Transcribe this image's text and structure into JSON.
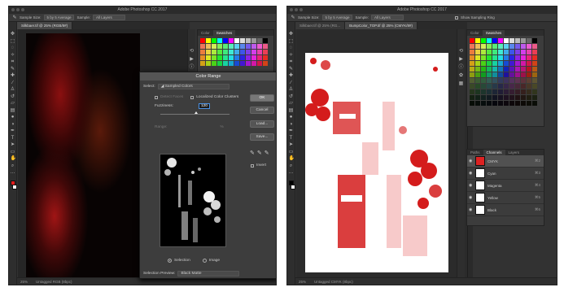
{
  "app_title": "Adobe Photoshop CC 2017",
  "left": {
    "options": {
      "sample_size_label": "Sample Size:",
      "sample_size_value": "5 by 5 Average",
      "sample_label": "Sample:",
      "sample_value": "All Layers"
    },
    "doc_tab": "Silkbaer.tif @ 25% (RGB/8#)",
    "status_zoom": "25%",
    "status_profile": "Untagged RGB (8bpc)",
    "panel_tabs": [
      "Color",
      "Swatches"
    ],
    "dialog": {
      "title": "Color Range",
      "select_label": "Select:",
      "select_value": "Sampled Colors",
      "detect_faces": "Detect Faces",
      "localized": "Localized Color Clusters",
      "fuzziness_label": "Fuzziness:",
      "fuzziness_value": "120",
      "range_label": "Range:",
      "range_unit": "%",
      "buttons": [
        "OK",
        "Cancel",
        "Load...",
        "Save..."
      ],
      "invert": "Invert",
      "selection_label": "Selection",
      "image_label": "Image",
      "preview_label": "Selection Preview:",
      "preview_value": "Black Matte"
    }
  },
  "right": {
    "options": {
      "sample_size_label": "Sample Size:",
      "sample_size_value": "5 by 5 Average",
      "sample_label": "Sample:",
      "sample_value": "All Layers",
      "extra": "Show Sampling Ring"
    },
    "doc_tabs": [
      "Silkbaer.tif @ 25% (RG...",
      "BumpColor_TOP.tif @ 25% (CMYK/8#)"
    ],
    "status_zoom": "25%",
    "status_profile": "Untagged CMYK (8bpc)",
    "panel_tabs": [
      "Color",
      "Swatches"
    ],
    "channel_tabs": [
      "Paths",
      "Channels",
      "Layers"
    ],
    "channels": [
      {
        "name": "CMYK",
        "key": "⌘2",
        "thumb": "#d22"
      },
      {
        "name": "Cyan",
        "key": "⌘3",
        "thumb": "#fff"
      },
      {
        "name": "Magenta",
        "key": "⌘4",
        "thumb": "#fff"
      },
      {
        "name": "Yellow",
        "key": "⌘5",
        "thumb": "#fff"
      },
      {
        "name": "Black",
        "key": "⌘6",
        "thumb": "#fff"
      }
    ]
  }
}
